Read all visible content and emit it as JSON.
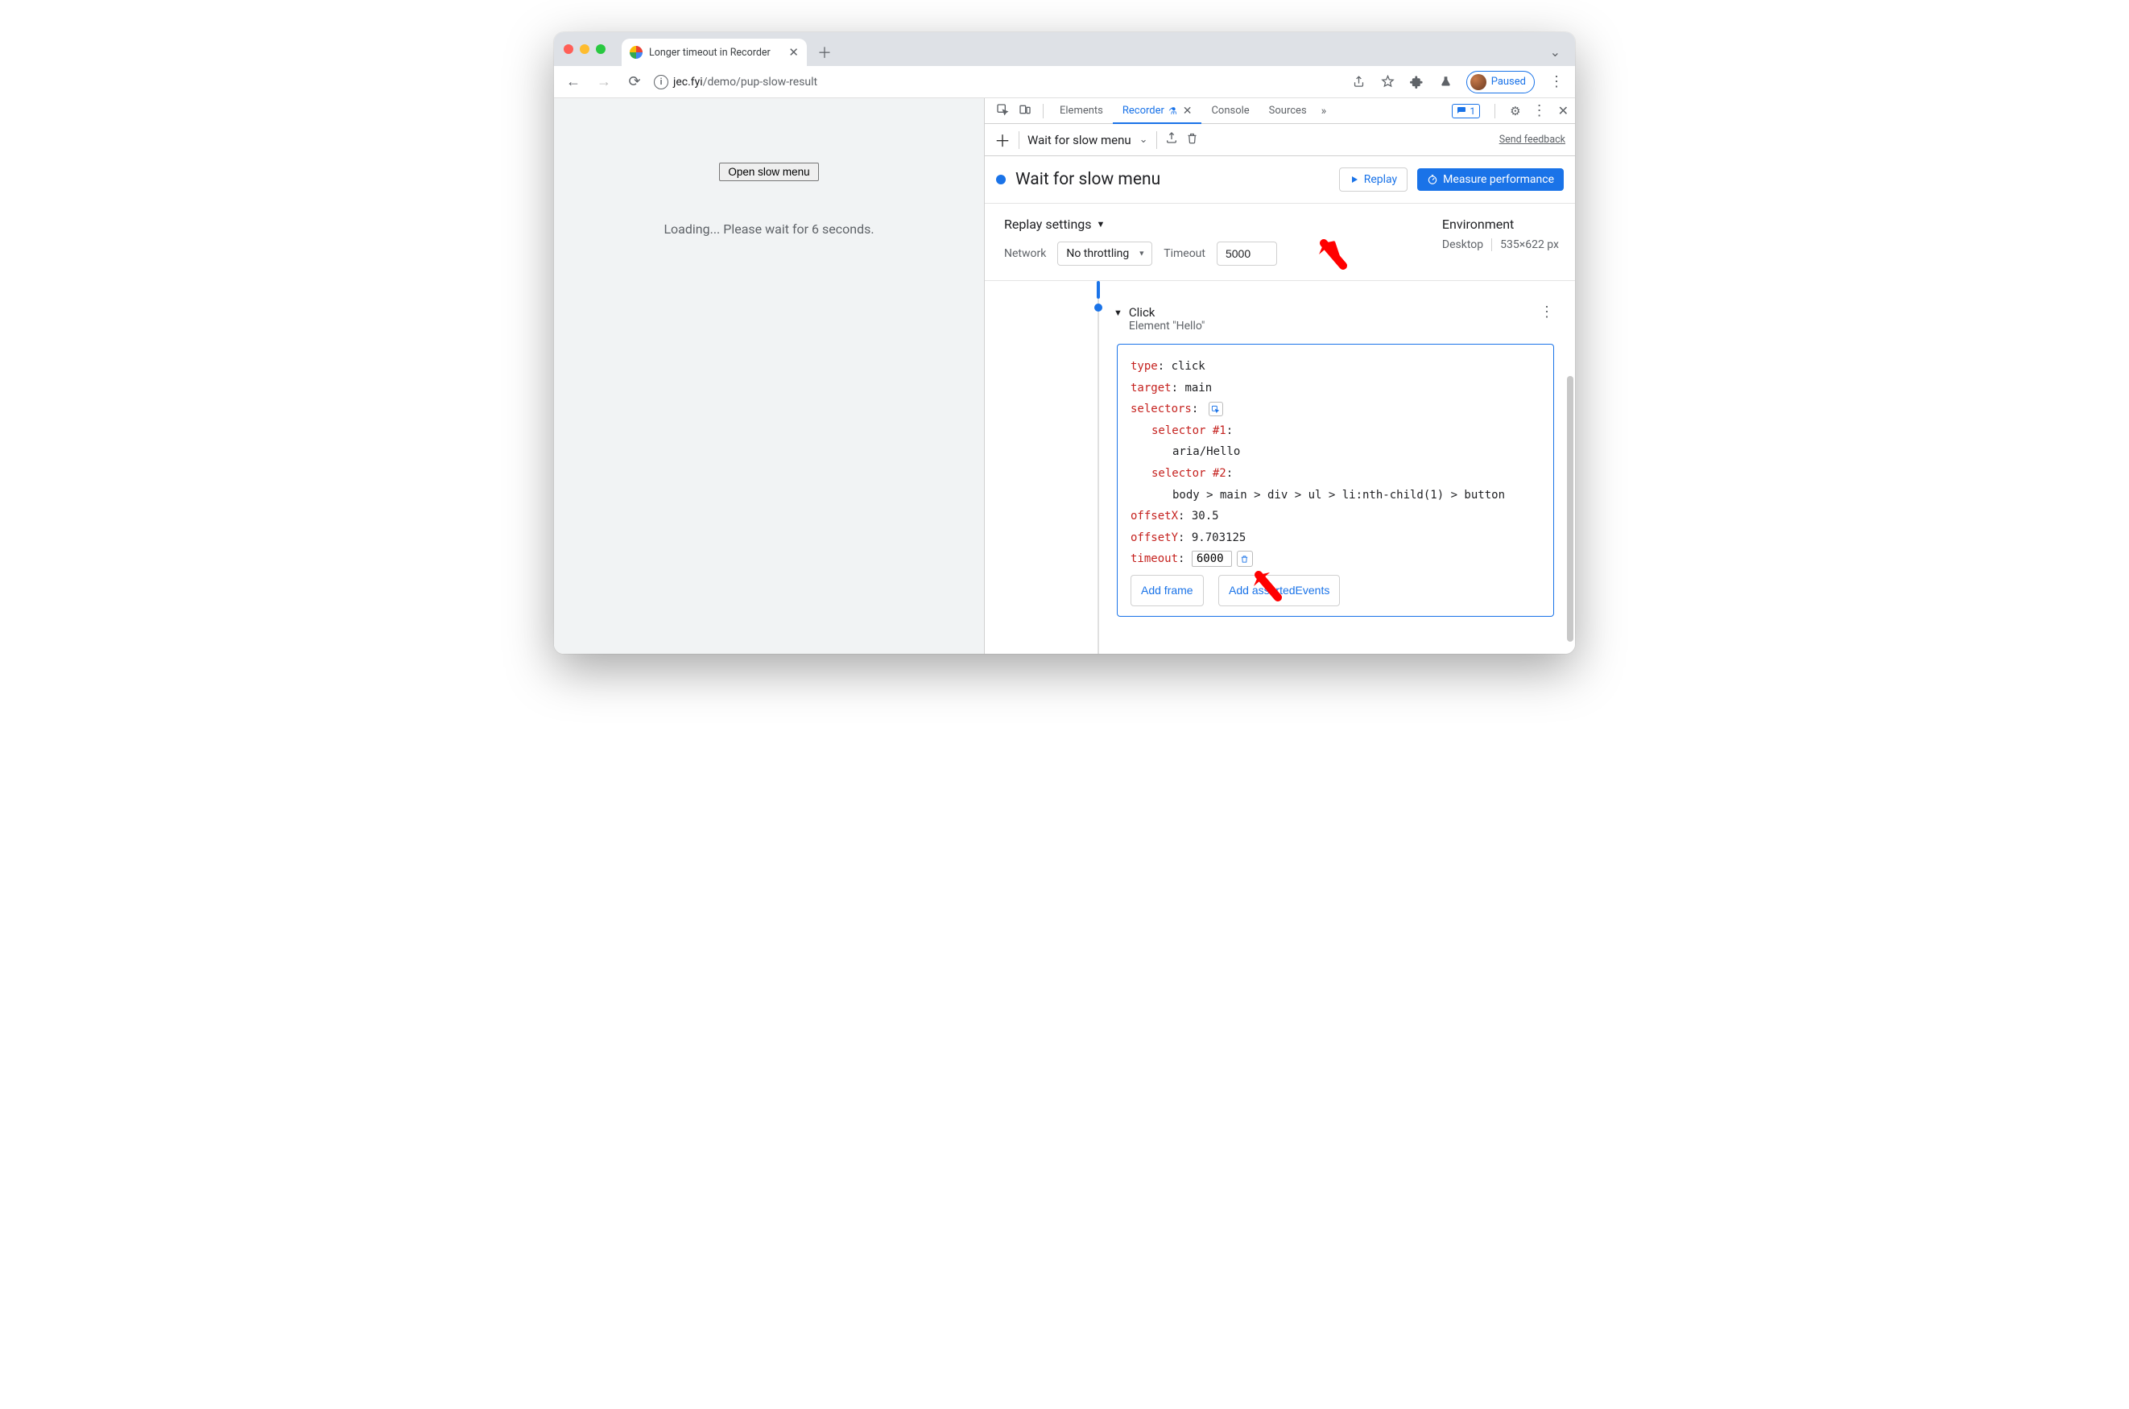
{
  "browser": {
    "tab_title": "Longer timeout in Recorder",
    "url_host": "jec.fyi",
    "url_path": "/demo/pup-slow-result",
    "profile_status": "Paused"
  },
  "page": {
    "button_label": "Open slow menu",
    "loading_text": "Loading... Please wait for 6 seconds."
  },
  "devtools": {
    "tabs": {
      "elements": "Elements",
      "recorder": "Recorder",
      "console": "Console",
      "sources": "Sources"
    },
    "issues_count": "1",
    "toolbar": {
      "recording_dropdown": "Wait for slow menu",
      "send_feedback": "Send feedback"
    },
    "header": {
      "recording_name": "Wait for slow menu",
      "replay_label": "Replay",
      "measure_label": "Measure performance"
    },
    "settings": {
      "title": "Replay settings",
      "network_label": "Network",
      "network_value": "No throttling",
      "timeout_label": "Timeout",
      "timeout_value": "5000",
      "env_title": "Environment",
      "env_device": "Desktop",
      "env_size": "535×622 px"
    },
    "step": {
      "title": "Click",
      "subtitle": "Element \"Hello\"",
      "type_key": "type",
      "type_val": "click",
      "target_key": "target",
      "target_val": "main",
      "selectors_key": "selectors",
      "sel1_key": "selector #1",
      "sel1_val": "aria/Hello",
      "sel2_key": "selector #2",
      "sel2_val": "body > main > div > ul > li:nth-child(1) > button",
      "offsetX_key": "offsetX",
      "offsetX_val": "30.5",
      "offsetY_key": "offsetY",
      "offsetY_val": "9.703125",
      "timeout_key": "timeout",
      "timeout_val": "6000",
      "add_frame": "Add frame",
      "add_asserted": "Add assertedEvents"
    }
  }
}
